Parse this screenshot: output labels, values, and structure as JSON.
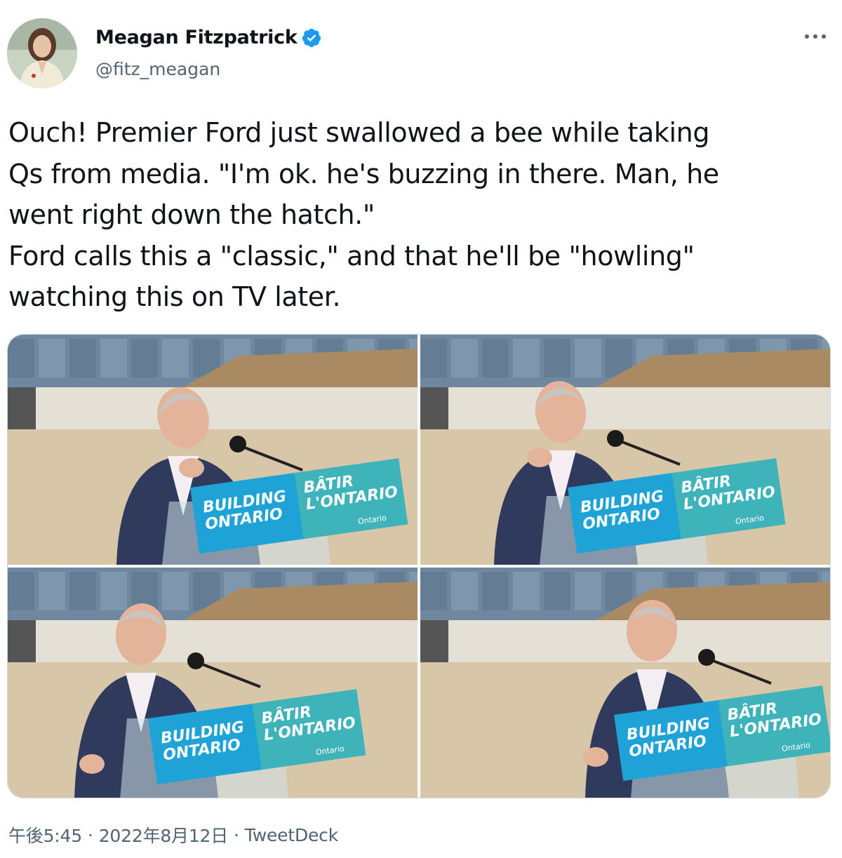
{
  "author": {
    "display_name": "Meagan Fitzpatrick",
    "handle": "@fitz_meagan",
    "verified": true
  },
  "tweet": {
    "lines": [
      "Ouch! Premier Ford just swallowed a bee while taking",
      "Qs from media. \"I'm ok. he's buzzing in there. Man, he",
      "went right down the hatch.\"",
      "Ford calls this a \"classic,\" and that he'll be \"howling\"",
      "watching this on TV later."
    ]
  },
  "media": {
    "photos": [
      {
        "sign_left_top": "BUILDING",
        "sign_left_bottom": "ONTARIO",
        "sign_right_top": "BÂTIR",
        "sign_right_bottom": "L'ONTARIO",
        "sign_logo": "Ontario"
      },
      {
        "sign_left_top": "BUILDING",
        "sign_left_bottom": "ONTARIO",
        "sign_right_top": "BÂTIR",
        "sign_right_bottom": "L'ONTARIO",
        "sign_logo": "Ontario"
      },
      {
        "sign_left_top": "BUILDING",
        "sign_left_bottom": "ONTARIO",
        "sign_right_top": "BÂTIR",
        "sign_right_bottom": "L'ONTARIO",
        "sign_logo": "Ontario"
      },
      {
        "sign_left_top": "BUILDING",
        "sign_left_bottom": "ONTARIO",
        "sign_right_top": "BÂTIR",
        "sign_right_bottom": "L'ONTARIO",
        "sign_logo": "Ontario"
      }
    ]
  },
  "meta": {
    "time": "午後5:45",
    "separator": "·",
    "date": "2022年8月12日",
    "source": "TweetDeck"
  },
  "icons": {
    "verified": "verified-badge-icon",
    "more": "more-options-icon"
  },
  "colors": {
    "text": "#0f1419",
    "secondary": "#536471",
    "verified_blue": "#1d9bf0",
    "sign_blue": "#1fa3d6",
    "sign_teal": "#4bb8b0"
  }
}
